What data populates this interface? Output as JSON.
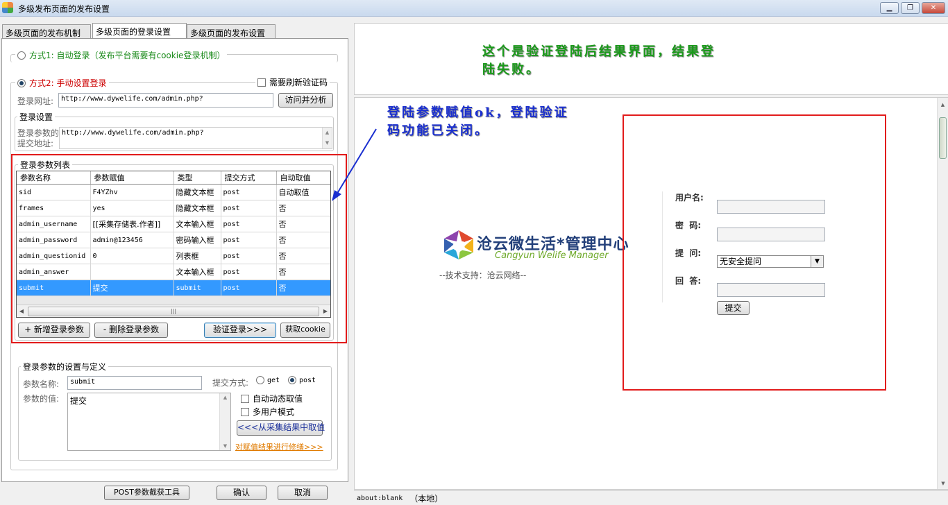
{
  "window": {
    "title": "多级发布页面的发布设置"
  },
  "tabs": [
    "多级页面的发布机制",
    "多级页面的登录设置",
    "多级页面的发布设置"
  ],
  "mode1": {
    "label": "方式1: 自动登录（发布平台需要有cookie登录机制）"
  },
  "mode2": {
    "label": "方式2: 手动设置登录",
    "refresh_captcha": "需要刷新验证码"
  },
  "login_url": {
    "label": "登录网址:",
    "value": "http://www.dywelife.com/admin.php?",
    "visit_button": "访问并分析"
  },
  "login_settings": {
    "title": "登录设置",
    "submit_label_1": "登录参数的",
    "submit_label_2": "提交地址:",
    "submit_value": "http://www.dywelife.com/admin.php?"
  },
  "params": {
    "title": "登录参数列表",
    "headers": [
      "参数名称",
      "参数赋值",
      "类型",
      "提交方式",
      "自动取值"
    ],
    "rows": [
      [
        "sid",
        "F4YZhv",
        "隐藏文本框",
        "post",
        "自动取值"
      ],
      [
        "frames",
        "yes",
        "隐藏文本框",
        "post",
        "否"
      ],
      [
        "admin_username",
        "[[采集存储表.作者]]",
        "文本输入框",
        "post",
        "否"
      ],
      [
        "admin_password",
        "admin@123456",
        "密码输入框",
        "post",
        "否"
      ],
      [
        "admin_questionid",
        "0",
        "列表框",
        "post",
        "否"
      ],
      [
        "admin_answer",
        "",
        "文本输入框",
        "post",
        "否"
      ],
      [
        "submit",
        "提交",
        "submit",
        "post",
        "否"
      ]
    ],
    "scroll_grip": "|||"
  },
  "param_buttons": {
    "add": "+ 新增登录参数",
    "delete": "- 删除登录参数",
    "verify": "验证登录>>>",
    "get_cookie": "获取cookie"
  },
  "definition": {
    "title": "登录参数的设置与定义",
    "name_label": "参数名称:",
    "name_value": "submit",
    "method_label": "提交方式:",
    "get_label": "get",
    "post_label": "post",
    "value_label": "参数的值:",
    "value_text": "提交",
    "auto_dynamic": "自动动态取值",
    "multi_user": "多用户模式",
    "from_collect": "<<<从采集结果中取值",
    "modify_link": "对赋值结果进行修缮>>>"
  },
  "bottom_buttons": {
    "post_tool": "POST参数截获工具",
    "ok": "确认",
    "cancel": "取消"
  },
  "annotations": {
    "result_note": "这个是验证登陆后结果界面，结果登陆失败。",
    "param_note": "登陆参数赋值ok，登陆验证码功能已关闭。"
  },
  "preview": {
    "brand_cn": "沧云微生活*管理中心",
    "brand_en": "Cangyun Welife Manager",
    "support": "--技术支持：沧云网络--",
    "username_label": "用户名:",
    "password_label": "密  码:",
    "question_label": "提  问:",
    "answer_label": "回  答:",
    "question_selected": "无安全提问",
    "submit_button": "提交"
  },
  "statusbar": {
    "url": "about:blank",
    "zone": "（本地）"
  },
  "colors": {
    "annotation_green": "#1a9a1a",
    "annotation_blue": "#1a2fd0",
    "red_box": "#e21b1b",
    "selection": "#3399ff"
  }
}
